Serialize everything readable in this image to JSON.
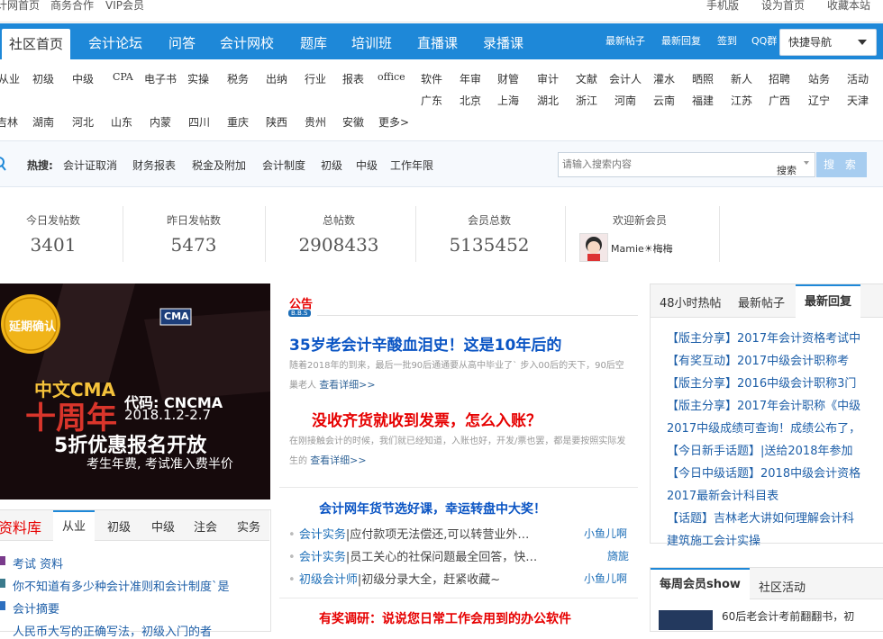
{
  "topbar": {
    "left": [
      "计网首页",
      "商务合作",
      "VIP会员"
    ],
    "right": [
      "手机版",
      "设为首页",
      "收藏本站"
    ]
  },
  "nav": {
    "items": [
      "社区首页",
      "会计论坛",
      "问答",
      "会计网校",
      "题库",
      "培训班",
      "直播课",
      "录播课"
    ],
    "right_links": [
      "最新帖子",
      "最新回复",
      "签到",
      "QQ群"
    ],
    "quick_nav": "快捷导航"
  },
  "categories": {
    "row1": [
      "从业",
      "初级",
      "中级",
      "CPA",
      "电子书",
      "实操",
      "税务",
      "出纳",
      "行业",
      "报表",
      "office",
      "软件",
      "年审",
      "财管",
      "审计",
      "文献",
      "会计人",
      "灌水",
      "晒照",
      "新人",
      "招聘",
      "站务",
      "活动"
    ],
    "row2": [
      "广东",
      "北京",
      "上海",
      "湖北",
      "浙江",
      "河南",
      "云南",
      "福建",
      "江苏",
      "广西",
      "辽宁",
      "天津"
    ],
    "row3": [
      "吉林",
      "湖南",
      "河北",
      "山东",
      "内蒙",
      "四川",
      "重庆",
      "陕西",
      "贵州",
      "安徽",
      "更多>"
    ]
  },
  "hot_search": {
    "label": "热搜:",
    "items": [
      "会计证取消",
      "财务报表",
      "税金及附加",
      "会计制度",
      "初级",
      "中级",
      "工作年限"
    ],
    "placeholder": "请输入搜索内容",
    "select_label": "搜索",
    "button": "搜 索"
  },
  "stats": [
    {
      "label": "今日发帖数",
      "value": "3401"
    },
    {
      "label": "昨日发帖数",
      "value": "5473"
    },
    {
      "label": "总帖数",
      "value": "2908433"
    },
    {
      "label": "会员总数",
      "value": "5135452"
    }
  ],
  "welcome": {
    "label": "欢迎新会员",
    "member": "Mamie☀梅梅"
  },
  "banner": {
    "badge": "延期确认",
    "logo": "CMA",
    "brand": "中文CMA",
    "code": "代码: CNCMA",
    "dates": "2018.1.2-2.7",
    "years": "十周年",
    "headline": "5折优惠报名开放",
    "sub": "考生年费, 考试准入费半价"
  },
  "announcement": {
    "label": "公告",
    "tag": "B.B.S",
    "title1": "35岁老会计辛酸血泪史！这是10年后的",
    "desc1": "随着2018年的到来，最后一批90后通通要从高中毕业了` 步入00后的天下，90后空巢老人",
    "more": "查看详细>>",
    "title2": "没收齐货就收到发票，怎么入账？",
    "desc2": "在刚接触会计的时候，我们就已经知道，入账也好，开发/票也罢，都是要按照实际发生的",
    "promo": "会计网年货节选好课，幸运转盘中大奖！",
    "survey": "有奖调研：说说您日常工作会用到的办公软件"
  },
  "news": [
    {
      "category": "会计实务",
      "text": "|应付款项无法偿还,可以转营业外…",
      "author": "小鱼儿啊"
    },
    {
      "category": "会计实务",
      "text": "|员工关心的社保问题最全回答，快…",
      "author": "旖旎"
    },
    {
      "category": "初级会计师",
      "text": "|初级分录大全，赶紧收藏~",
      "author": "小鱼儿啊"
    }
  ],
  "right_tabs": [
    "48小时热帖",
    "最新帖子",
    "最新回复"
  ],
  "right_list": [
    "【版主分享】2017年会计资格考试中",
    "【有奖互动】2017中级会计职称考",
    "【版主分享】2016中级会计职称3门",
    "【版主分享】2017年会计职称《中级",
    "2017中级成绩可查询！成绩公布了，",
    "【今日新手话题】|送给2018年参加",
    "【今日中级话题】2018中级会计资格",
    "2017最新会计科目表",
    "【话题】吉林老大讲如何理解会计科",
    "建筑施工会计实操"
  ],
  "datalib": {
    "title": "资料库",
    "tabs": [
      "从业",
      "初级",
      "中级",
      "注会",
      "实务"
    ],
    "items": [
      "考试 资料",
      "你不知道有多少种会计准则和会计制度`是",
      "会计摘要",
      "人民币大写的正确写法，初级入门的者"
    ]
  },
  "weekly": {
    "tabs": [
      "每周会员show",
      "社区活动"
    ],
    "text": "60后老会计考前翻翻书，初"
  },
  "colors": {
    "nav": "#1e88d8",
    "link": "#1e5fa8",
    "title_blue": "#0b55c4",
    "title_red": "#e60000"
  }
}
